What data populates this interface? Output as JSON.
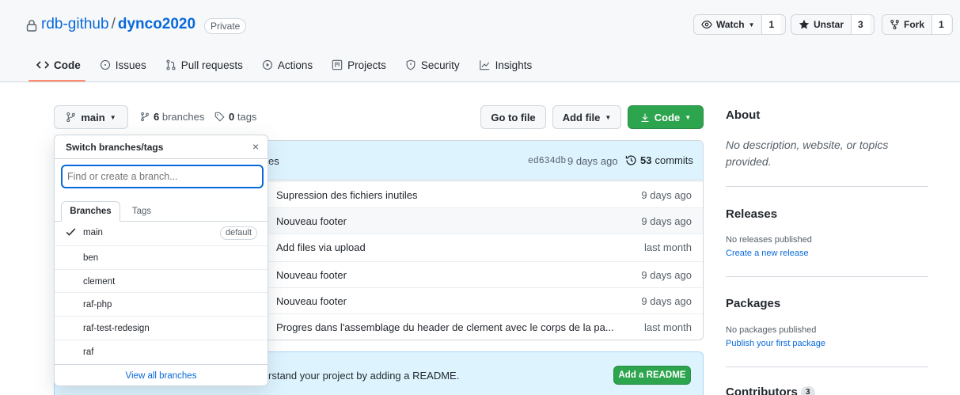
{
  "repo": {
    "owner": "rdb-github",
    "separator": "/",
    "name": "dynco2020",
    "visibility": "Private"
  },
  "header_buttons": {
    "watch_label": "Watch",
    "watch_count": "1",
    "star_label": "Unstar",
    "star_count": "3",
    "fork_label": "Fork",
    "fork_count": "1"
  },
  "tabs": [
    {
      "label": "Code",
      "icon": "code-icon",
      "active": true
    },
    {
      "label": "Issues",
      "icon": "issue-icon"
    },
    {
      "label": "Pull requests",
      "icon": "pull-request-icon"
    },
    {
      "label": "Actions",
      "icon": "play-icon"
    },
    {
      "label": "Projects",
      "icon": "project-icon"
    },
    {
      "label": "Security",
      "icon": "shield-icon"
    },
    {
      "label": "Insights",
      "icon": "graph-icon"
    }
  ],
  "branch_bar": {
    "current_branch": "main",
    "branches_count": "6",
    "branches_label": "branches",
    "tags_count": "0",
    "tags_label": "tags",
    "go_to_file": "Go to file",
    "add_file": "Add file",
    "code": "Code"
  },
  "commit_header": {
    "partial_text": "es",
    "sha": "ed634db",
    "age": "9 days ago",
    "commits_count": "53",
    "commits_label": "commits"
  },
  "files": [
    {
      "message": "Supression des fichiers inutiles",
      "age": "9 days ago"
    },
    {
      "message": "Nouveau footer",
      "age": "9 days ago"
    },
    {
      "message": "Add files via upload",
      "age": "last month"
    },
    {
      "message": "Nouveau footer",
      "age": "9 days ago"
    },
    {
      "message": "Nouveau footer",
      "age": "9 days ago"
    },
    {
      "message": "Progres dans l'assemblage du header de clement avec le corps de la pa...",
      "age": "last month"
    }
  ],
  "readme": {
    "text": "rstand your project by adding a README.",
    "button": "Add a README"
  },
  "dropdown": {
    "title": "Switch branches/tags",
    "close": "×",
    "placeholder": "Find or create a branch...",
    "tab_branches": "Branches",
    "tab_tags": "Tags",
    "items": [
      {
        "name": "main",
        "selected": true,
        "badge": "default"
      },
      {
        "name": "ben"
      },
      {
        "name": "clement"
      },
      {
        "name": "raf-php"
      },
      {
        "name": "raf-test-redesign"
      },
      {
        "name": "raf"
      }
    ],
    "footer": "View all branches"
  },
  "sidebar": {
    "about_title": "About",
    "about_text": "No description, website, or topics provided.",
    "releases_title": "Releases",
    "releases_text": "No releases published",
    "releases_link": "Create a new release",
    "packages_title": "Packages",
    "packages_text": "No packages published",
    "packages_link": "Publish your first package",
    "contributors_title": "Contributors",
    "contributors_count": "3"
  },
  "colors": {
    "link": "#0969da",
    "green": "#2da44e",
    "tab_underline": "#fd8c73",
    "commit_header_bg": "#ddf4ff"
  }
}
